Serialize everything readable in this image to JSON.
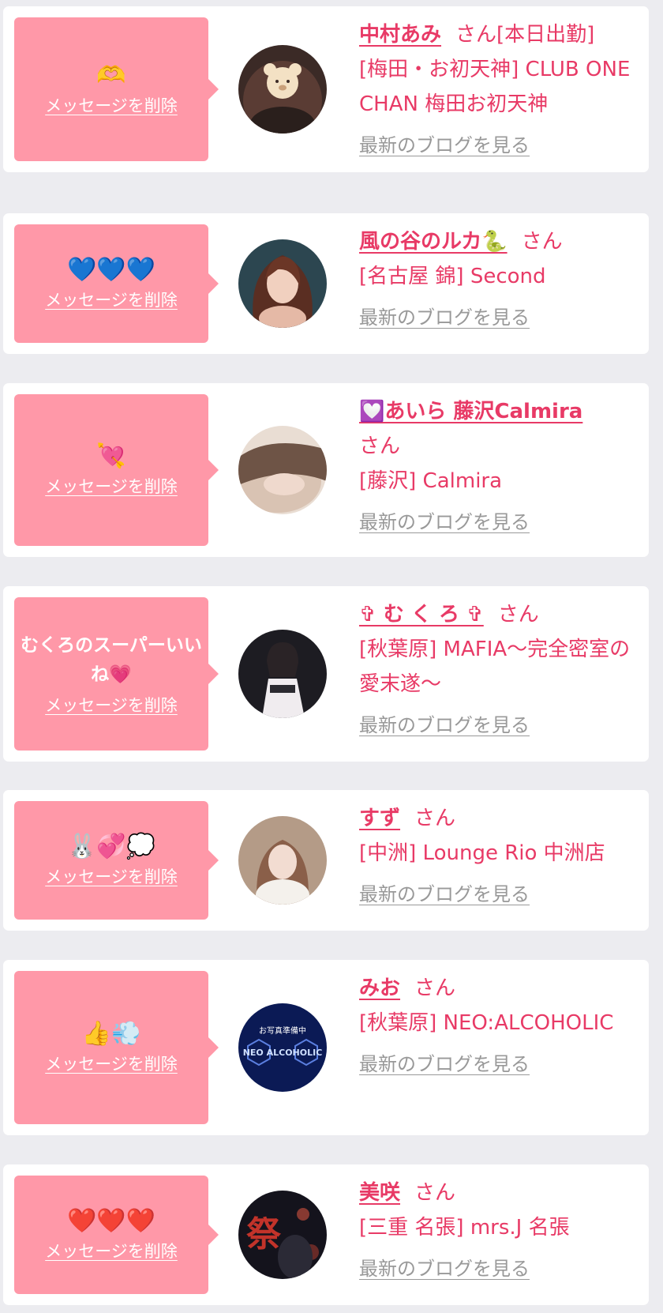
{
  "delete_label": "メッセージを削除",
  "blog_label": "最新のブログを見る",
  "san_label": "さん",
  "messages": [
    {
      "reaction": "🫶",
      "name": "中村あみ",
      "status": "[本日出勤]",
      "shop": "[梅田・お初天神] CLUB ONE CHAN 梅田お初天神",
      "avatar_theme": "bear-sticker"
    },
    {
      "reaction": "💙💙💙",
      "name": "風の谷のルカ🐍",
      "status": "",
      "shop": "[名古屋 錦] Second",
      "avatar_theme": "long-hair-portrait"
    },
    {
      "reaction": "💘",
      "name": "💟あいら 藤沢Calmira",
      "status": "",
      "shop": "[藤沢] Calmira",
      "avatar_theme": "blurred-face"
    },
    {
      "reaction": "むくろのスーパーいいね💗",
      "name": "✞ む く ろ ✞",
      "status": "",
      "shop": "[秋葉原] MAFIA〜完全密室の愛末遂〜",
      "avatar_theme": "gothic-dress"
    },
    {
      "reaction": "🐰💞💭",
      "name": "すず",
      "status": "",
      "shop": "[中洲] Lounge Rio 中洲店",
      "avatar_theme": "sweater-portrait"
    },
    {
      "reaction": "👍💨",
      "name": "みお",
      "status": "",
      "shop": "[秋葉原] NEO:ALCOHOLIC",
      "avatar_theme": "neo-alcoholic-logo",
      "avatar_text": "お写真準備中",
      "avatar_logo": "NEO ALCOHOLIC"
    },
    {
      "reaction": "❤️❤️❤️",
      "name": "美咲",
      "status": "",
      "shop": "[三重 名張] mrs.J 名張",
      "avatar_theme": "festival-night",
      "avatar_text": "祭"
    }
  ],
  "colors": {
    "page_bg": "#ececf0",
    "bubble": "#ff98a8",
    "accent": "#e83a66",
    "link_gray": "#999999"
  }
}
